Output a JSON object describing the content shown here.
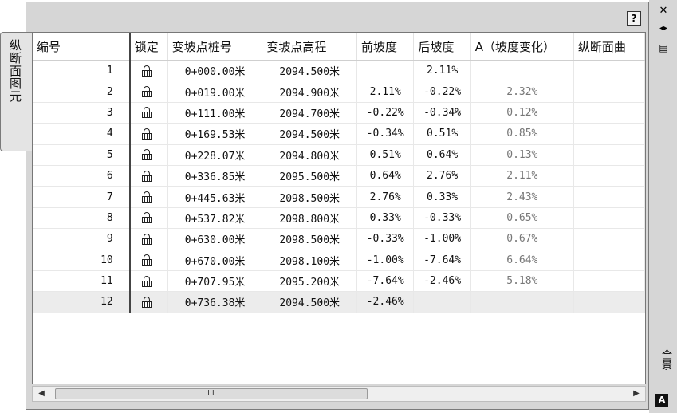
{
  "panel": {
    "tab_label": "纵断面图元",
    "help_label": "?",
    "side_strip_label": "全景",
    "corner_label": "A"
  },
  "icons": {
    "close": "close-icon",
    "auto_hide": "auto-hide-icon",
    "properties": "properties-icon",
    "lock": "padlock-icon",
    "scroll_left": "arrow-left-icon",
    "scroll_right": "arrow-right-icon"
  },
  "table": {
    "columns": [
      "编号",
      "锁定",
      "变坡点桩号",
      "变坡点高程",
      "前坡度",
      "后坡度",
      "A（坡度变化）",
      "纵断面曲"
    ],
    "rows": [
      {
        "no": "1",
        "station": "0+000.00米",
        "elevation": "2094.500米",
        "grade_in": "",
        "grade_out": "2.11%",
        "delta": ""
      },
      {
        "no": "2",
        "station": "0+019.00米",
        "elevation": "2094.900米",
        "grade_in": "2.11%",
        "grade_out": "-0.22%",
        "delta": "2.32%"
      },
      {
        "no": "3",
        "station": "0+111.00米",
        "elevation": "2094.700米",
        "grade_in": "-0.22%",
        "grade_out": "-0.34%",
        "delta": "0.12%"
      },
      {
        "no": "4",
        "station": "0+169.53米",
        "elevation": "2094.500米",
        "grade_in": "-0.34%",
        "grade_out": "0.51%",
        "delta": "0.85%"
      },
      {
        "no": "5",
        "station": "0+228.07米",
        "elevation": "2094.800米",
        "grade_in": "0.51%",
        "grade_out": "0.64%",
        "delta": "0.13%"
      },
      {
        "no": "6",
        "station": "0+336.85米",
        "elevation": "2095.500米",
        "grade_in": "0.64%",
        "grade_out": "2.76%",
        "delta": "2.11%"
      },
      {
        "no": "7",
        "station": "0+445.63米",
        "elevation": "2098.500米",
        "grade_in": "2.76%",
        "grade_out": "0.33%",
        "delta": "2.43%"
      },
      {
        "no": "8",
        "station": "0+537.82米",
        "elevation": "2098.800米",
        "grade_in": "0.33%",
        "grade_out": "-0.33%",
        "delta": "0.65%"
      },
      {
        "no": "9",
        "station": "0+630.00米",
        "elevation": "2098.500米",
        "grade_in": "-0.33%",
        "grade_out": "-1.00%",
        "delta": "0.67%"
      },
      {
        "no": "10",
        "station": "0+670.00米",
        "elevation": "2098.100米",
        "grade_in": "-1.00%",
        "grade_out": "-7.64%",
        "delta": "6.64%"
      },
      {
        "no": "11",
        "station": "0+707.95米",
        "elevation": "2095.200米",
        "grade_in": "-7.64%",
        "grade_out": "-2.46%",
        "delta": "5.18%"
      },
      {
        "no": "12",
        "station": "0+736.38米",
        "elevation": "2094.500米",
        "grade_in": "-2.46%",
        "grade_out": "",
        "delta": ""
      }
    ],
    "selected_row": 12
  },
  "scrollbar": {
    "grip": "III"
  }
}
